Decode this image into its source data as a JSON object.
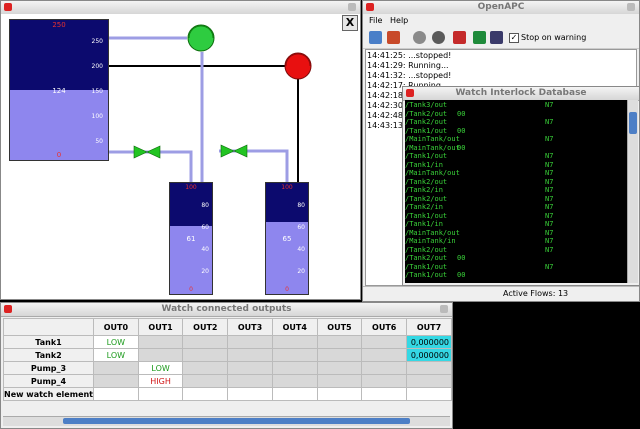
{
  "colors": {
    "tank_dark": "#0c0a6e",
    "tank_light": "#8e86ee",
    "pipe_blue": "#9d9de4",
    "pipe_black": "#000000",
    "pump_on": "#2ecc40",
    "pump_off": "#e81010",
    "valve_green": "#22c422",
    "cell_cyan": "#34d8e4",
    "text_green": "#1a9a1a",
    "text_red": "#d01818",
    "term_green": "#39d139"
  },
  "hmi": {
    "close_label": "X",
    "main_tank": {
      "top_value": "250",
      "level_value": "124",
      "bottom_value": "0",
      "ticks": [
        "250",
        "200",
        "150",
        "100",
        "50"
      ],
      "fill_level": 0.5
    },
    "tank1": {
      "top_value": "100",
      "level_value": "61",
      "bottom_value": "0",
      "ticks": [
        "80",
        "60",
        "40",
        "20"
      ],
      "fill_level": 0.61
    },
    "tank2": {
      "top_value": "100",
      "level_value": "65",
      "bottom_value": "0",
      "ticks": [
        "80",
        "60",
        "40",
        "20"
      ],
      "fill_level": 0.65
    }
  },
  "openapc": {
    "title": "OpenAPC",
    "menu": [
      "File",
      "Help"
    ],
    "stop_on_warning_label": "Stop on warning",
    "stop_on_warning_checked": true,
    "toolbar_icons": [
      "open-icon",
      "exit-icon",
      "settings-icon",
      "search-icon",
      "flow-icon",
      "run-icon",
      "tools-icon"
    ],
    "log": [
      "14:41:25: ...stopped!",
      "14:41:29: Running...",
      "14:41:32: ...stopped!",
      "14:42:17: Running...",
      "14:42:18:",
      "14:42:30:",
      "14:42:48:",
      "14:43:13:"
    ]
  },
  "interlock": {
    "title": "Watch Interlock Database",
    "status": "Active Flows: 13",
    "entries": [
      {
        "path": "/Tank3/out",
        "value": "",
        "extra": "N7"
      },
      {
        "path": "/Tank2/out",
        "value": "00",
        "extra": ""
      },
      {
        "path": "/Tank2/out",
        "value": "",
        "extra": "N7"
      },
      {
        "path": "/Tank1/out",
        "value": "00",
        "extra": ""
      },
      {
        "path": "/MainTank/out",
        "value": "",
        "extra": "N7"
      },
      {
        "path": "/MainTank/out",
        "value": "00",
        "extra": ""
      },
      {
        "path": "/Tank1/out",
        "value": "",
        "extra": "N7"
      },
      {
        "path": "/Tank1/in",
        "value": "",
        "extra": "N7"
      },
      {
        "path": "/MainTank/out",
        "value": "",
        "extra": "N7"
      },
      {
        "path": "/Tank2/out",
        "value": "",
        "extra": "N7"
      },
      {
        "path": "/Tank2/in",
        "value": "",
        "extra": "N7"
      },
      {
        "path": "/Tank2/out",
        "value": "",
        "extra": "N7"
      },
      {
        "path": "/Tank2/in",
        "value": "",
        "extra": "N7"
      },
      {
        "path": "/Tank1/out",
        "value": "",
        "extra": "N7"
      },
      {
        "path": "/Tank1/in",
        "value": "",
        "extra": "N7"
      },
      {
        "path": "/MainTank/out",
        "value": "",
        "extra": "N7"
      },
      {
        "path": "/MainTank/in",
        "value": "",
        "extra": "N7"
      },
      {
        "path": "/Tank2/out",
        "value": "",
        "extra": "N7"
      },
      {
        "path": "/Tank2/out",
        "value": "00",
        "extra": ""
      },
      {
        "path": "/Tank1/out",
        "value": "",
        "extra": "N7"
      },
      {
        "path": "/Tank1/out",
        "value": "00",
        "extra": ""
      }
    ]
  },
  "outputs": {
    "title": "Watch connected outputs",
    "columns": [
      "OUT0",
      "OUT1",
      "OUT2",
      "OUT3",
      "OUT4",
      "OUT5",
      "OUT6",
      "OUT7"
    ],
    "rows": [
      {
        "label": "Tank1",
        "cells": [
          "LOW",
          "",
          "",
          "",
          "",
          "",
          "",
          "0,000000"
        ]
      },
      {
        "label": "Tank2",
        "cells": [
          "LOW",
          "",
          "",
          "",
          "",
          "",
          "",
          "0,000000"
        ]
      },
      {
        "label": "Pump_3",
        "cells": [
          "",
          "LOW",
          "",
          "",
          "",
          "",
          "",
          ""
        ]
      },
      {
        "label": "Pump_4",
        "cells": [
          "",
          "HIGH",
          "",
          "",
          "",
          "",
          "",
          ""
        ]
      },
      {
        "label": "New watch element",
        "cells": [
          "",
          "",
          "",
          "",
          "",
          "",
          "",
          ""
        ]
      }
    ]
  }
}
